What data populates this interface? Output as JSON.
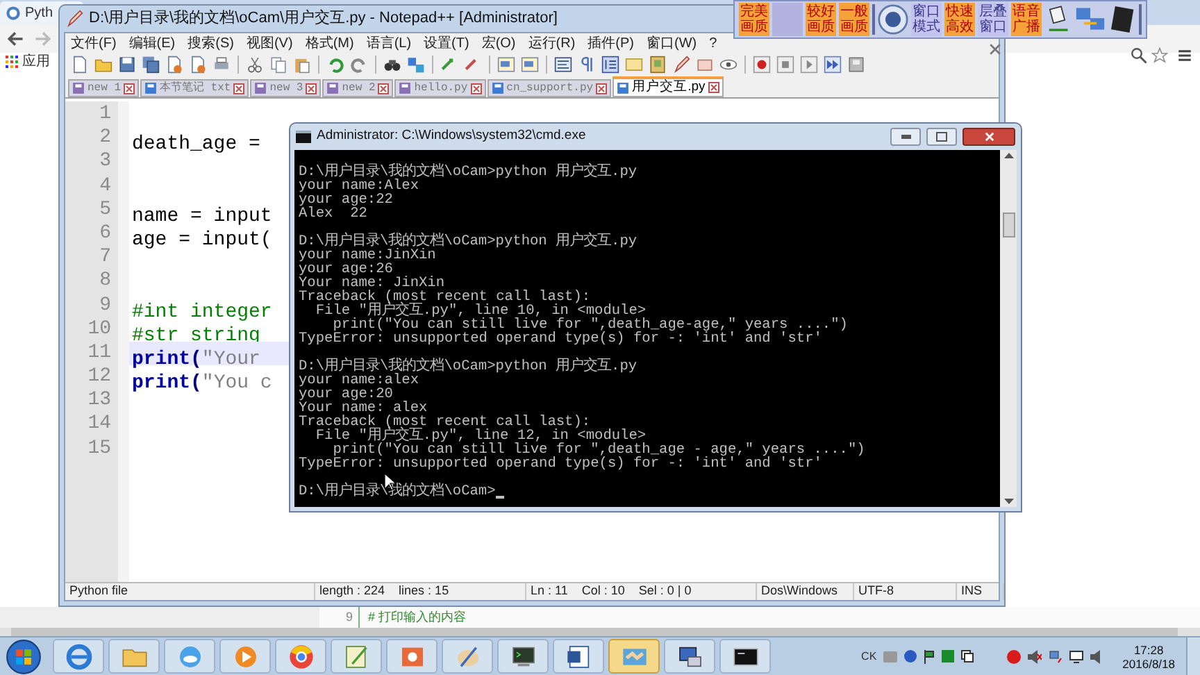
{
  "browser": {
    "tab_title": "Pyth",
    "bookmarks": [
      {
        "label": "应用"
      }
    ],
    "page_code": {
      "line_number": "9",
      "text": "# 打印输入的内容"
    }
  },
  "capture_toolbar": {
    "buttons": [
      {
        "kind": "text",
        "label": "完美画质",
        "enabled": true
      },
      {
        "kind": "blank",
        "enabled": false
      },
      {
        "kind": "text",
        "label": "较好画质",
        "enabled": true
      },
      {
        "kind": "text",
        "label": "一般画质",
        "enabled": true
      },
      {
        "kind": "separator"
      },
      {
        "kind": "icon"
      },
      {
        "kind": "text",
        "label": "窗口模式",
        "enabled": false
      },
      {
        "kind": "text",
        "label": "快速高效",
        "enabled": true
      },
      {
        "kind": "text",
        "label": "层叠窗口",
        "enabled": false
      },
      {
        "kind": "text",
        "label": "语音广播",
        "enabled": true
      },
      {
        "kind": "icon"
      },
      {
        "kind": "icon"
      },
      {
        "kind": "icon"
      },
      {
        "kind": "separator"
      }
    ]
  },
  "notepad": {
    "title": "D:\\用户目录\\我的文档\\oCam\\用户交互.py - Notepad++ [Administrator]",
    "menu": [
      "文件(F)",
      "编辑(E)",
      "搜索(S)",
      "视图(V)",
      "格式(M)",
      "语言(L)",
      "设置(T)",
      "宏(O)",
      "运行(R)",
      "插件(P)",
      "窗口(W)",
      "?"
    ],
    "tabs": [
      {
        "label": "new 1",
        "selected": false,
        "saved": false
      },
      {
        "label": "本节笔记 txt",
        "selected": false,
        "saved": true
      },
      {
        "label": "new 3",
        "selected": false,
        "saved": false
      },
      {
        "label": "new 2",
        "selected": false,
        "saved": false
      },
      {
        "label": "hello.py",
        "selected": false,
        "saved": false
      },
      {
        "label": "cn_support.py",
        "selected": false,
        "saved": true
      },
      {
        "label": "用户交互.py",
        "selected": true,
        "saved": true
      }
    ],
    "lines": [
      {
        "number": "1",
        "current": false
      },
      {
        "number": "2",
        "current": false,
        "tokens": [
          {
            "kind": "plain",
            "text": "death_age = "
          }
        ]
      },
      {
        "number": "3",
        "current": false
      },
      {
        "number": "4",
        "current": false
      },
      {
        "number": "5",
        "current": false,
        "tokens": [
          {
            "kind": "plain",
            "text": "name = input"
          }
        ]
      },
      {
        "number": "6",
        "current": false,
        "tokens": [
          {
            "kind": "plain",
            "text": "age = input("
          }
        ]
      },
      {
        "number": "7",
        "current": false
      },
      {
        "number": "8",
        "current": false
      },
      {
        "number": "9",
        "current": false,
        "tokens": [
          {
            "kind": "comment",
            "text": "#int integer"
          }
        ]
      },
      {
        "number": "10",
        "current": false,
        "tokens": [
          {
            "kind": "comment",
            "text": "#str string"
          }
        ]
      },
      {
        "number": "11",
        "current": true,
        "tokens": [
          {
            "kind": "keyword",
            "text": "print"
          },
          {
            "kind": "paren",
            "text": "("
          },
          {
            "kind": "string",
            "text": "\"Your"
          }
        ]
      },
      {
        "number": "12",
        "current": false,
        "tokens": [
          {
            "kind": "keyword",
            "text": "print"
          },
          {
            "kind": "paren",
            "text": "("
          },
          {
            "kind": "string",
            "text": "\"You c"
          }
        ]
      },
      {
        "number": "13",
        "current": false
      },
      {
        "number": "14",
        "current": false
      },
      {
        "number": "15",
        "current": false
      }
    ],
    "status_bar": [
      [
        "Python file"
      ],
      [
        "length : 224",
        "lines : 15"
      ],
      [
        "Ln : 11",
        "Col : 10",
        "Sel : 0 | 0"
      ],
      [
        "Dos\\Windows"
      ],
      [
        "UTF-8"
      ],
      [
        "INS"
      ]
    ]
  },
  "console": {
    "title": "Administrator: C:\\Windows\\system32\\cmd.exe",
    "blocks": [
      [
        "D:\\用户目录\\我的文档\\oCam>python 用户交互.py",
        "your name:Alex",
        "your age:22",
        "Alex  22"
      ],
      [
        "D:\\用户目录\\我的文档\\oCam>python 用户交互.py",
        "your name:JinXin",
        "your age:26",
        "Your name: JinXin",
        "Traceback (most recent call last):",
        "  File \"用户交互.py\", line 10, in <module>",
        "    print(\"You can still live for \",death_age-age,\" years ....\")",
        "TypeError: unsupported operand type(s) for -: 'int' and 'str'"
      ],
      [
        "D:\\用户目录\\我的文档\\oCam>python 用户交互.py",
        "your name:alex",
        "your age:20",
        "Your name: alex",
        "Traceback (most recent call last):",
        "  File \"用户交互.py\", line 12, in <module>",
        "    print(\"You can still live for \",death_age - age,\" years ....\")",
        "TypeError: unsupported operand type(s) for -: 'int' and 'str'"
      ]
    ],
    "prompt": "D:\\用户目录\\我的文档\\oCam>"
  },
  "taskbar": {
    "apps": [
      {
        "selected": false
      },
      {
        "selected": false
      },
      {
        "selected": false
      },
      {
        "selected": false
      },
      {
        "selected": false
      },
      {
        "selected": false
      },
      {
        "selected": false
      },
      {
        "selected": false
      },
      {
        "selected": false
      },
      {
        "selected": false
      },
      {
        "selected": true
      },
      {
        "selected": false
      },
      {
        "selected": false
      }
    ],
    "input_indicator": "CK",
    "time": "17:28",
    "date": "2016/8/18"
  }
}
